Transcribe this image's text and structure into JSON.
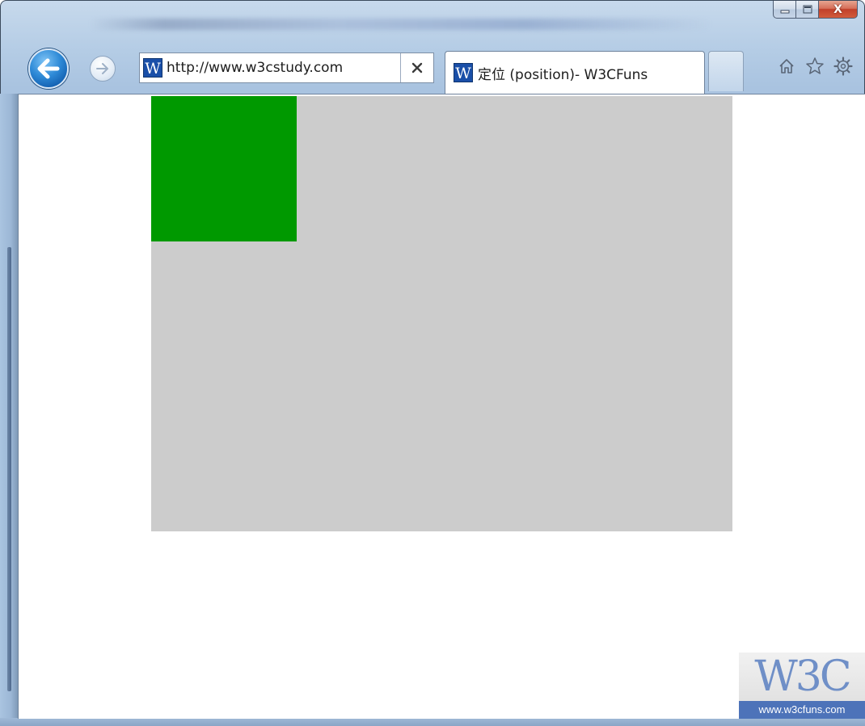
{
  "browser": {
    "address": {
      "favicon_letter": "W",
      "url": "http://www.w3cstudy.com"
    },
    "tab": {
      "favicon_letter": "W",
      "title": "定位 (position)- W3CFuns"
    },
    "caption_buttons": {
      "minimize_icon": "minimize-icon",
      "maximize_icon": "maximize-icon",
      "close_glyph": "X"
    },
    "command_icons": [
      "home-icon",
      "star-icon",
      "gear-icon"
    ]
  },
  "page": {
    "outer_box_color": "#cccccc",
    "inner_box_color": "#009900"
  },
  "watermark": {
    "logo": "W3C",
    "url": "www.w3cfuns.com"
  }
}
